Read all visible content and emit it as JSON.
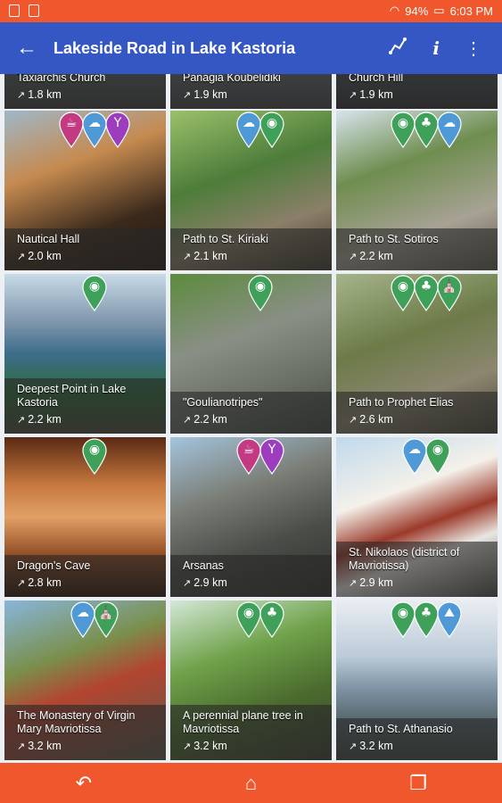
{
  "status_bar": {
    "battery": "94%",
    "time": "6:03 PM"
  },
  "app_bar": {
    "title": "Lakeside Road in Lake Kastoria"
  },
  "colors": {
    "status": "#f0572c",
    "app_bar": "#3557c4",
    "pin_green": "#3fa05a",
    "pin_blue": "#4f9ad6",
    "pin_magenta": "#c33a82",
    "pin_purple": "#9c3dbd"
  },
  "tiles": [
    {
      "name": "Taxiarchis Church",
      "distance": "1.8 km",
      "pins": []
    },
    {
      "name": "Panagia Koubelidiki",
      "distance": "1.9 km",
      "pins": []
    },
    {
      "name": "Church Hill",
      "distance": "1.9 km",
      "pins": []
    },
    {
      "name": "Nautical Hall",
      "distance": "2.0 km",
      "pins": [
        {
          "color": "magenta",
          "icon": "cafe-icon"
        },
        {
          "color": "blue",
          "icon": "sightseeing-icon"
        },
        {
          "color": "purple",
          "icon": "cocktail-icon"
        }
      ]
    },
    {
      "name": "Path to St. Kiriaki",
      "distance": "2.1 km",
      "pins": [
        {
          "color": "blue",
          "icon": "sightseeing-icon"
        },
        {
          "color": "green",
          "icon": "camera-icon"
        }
      ]
    },
    {
      "name": "Path to St. Sotiros",
      "distance": "2.2 km",
      "pins": [
        {
          "color": "green",
          "icon": "camera-icon"
        },
        {
          "color": "green",
          "icon": "tree-icon"
        },
        {
          "color": "blue",
          "icon": "sightseeing-icon"
        }
      ]
    },
    {
      "name": "Deepest Point in Lake Kastoria",
      "distance": "2.2 km",
      "pins": [
        {
          "color": "green",
          "icon": "camera-icon"
        }
      ]
    },
    {
      "name": "\"Goulianotripes\"",
      "distance": "2.2 km",
      "pins": [
        {
          "color": "green",
          "icon": "camera-icon"
        }
      ]
    },
    {
      "name": "Path to Prophet Elias",
      "distance": "2.6 km",
      "pins": [
        {
          "color": "green",
          "icon": "camera-icon"
        },
        {
          "color": "green",
          "icon": "tree-icon"
        },
        {
          "color": "green",
          "icon": "church-icon"
        }
      ]
    },
    {
      "name": "Dragon's Cave",
      "distance": "2.8 km",
      "pins": [
        {
          "color": "green",
          "icon": "camera-icon"
        }
      ]
    },
    {
      "name": "Arsanas",
      "distance": "2.9 km",
      "pins": [
        {
          "color": "magenta",
          "icon": "cafe-icon"
        },
        {
          "color": "purple",
          "icon": "cocktail-icon"
        }
      ]
    },
    {
      "name": "St. Nikolaos (district of Mavriotissa)",
      "distance": "2.9 km",
      "pins": [
        {
          "color": "blue",
          "icon": "sightseeing-icon"
        },
        {
          "color": "green",
          "icon": "camera-icon"
        }
      ]
    },
    {
      "name": "The Monastery of Virgin Mary Mavriotissa",
      "distance": "3.2 km",
      "pins": [
        {
          "color": "blue",
          "icon": "sightseeing-icon"
        },
        {
          "color": "green",
          "icon": "church-icon"
        }
      ]
    },
    {
      "name": "A perennial plane tree in Mavriotissa",
      "distance": "3.2 km",
      "pins": [
        {
          "color": "green",
          "icon": "camera-icon"
        },
        {
          "color": "green",
          "icon": "tree-icon"
        }
      ]
    },
    {
      "name": "Path to St. Athanasio",
      "distance": "3.2 km",
      "pins": [
        {
          "color": "green",
          "icon": "camera-icon"
        },
        {
          "color": "green",
          "icon": "tree-icon"
        },
        {
          "color": "blue",
          "icon": "hiking-icon"
        }
      ]
    }
  ]
}
